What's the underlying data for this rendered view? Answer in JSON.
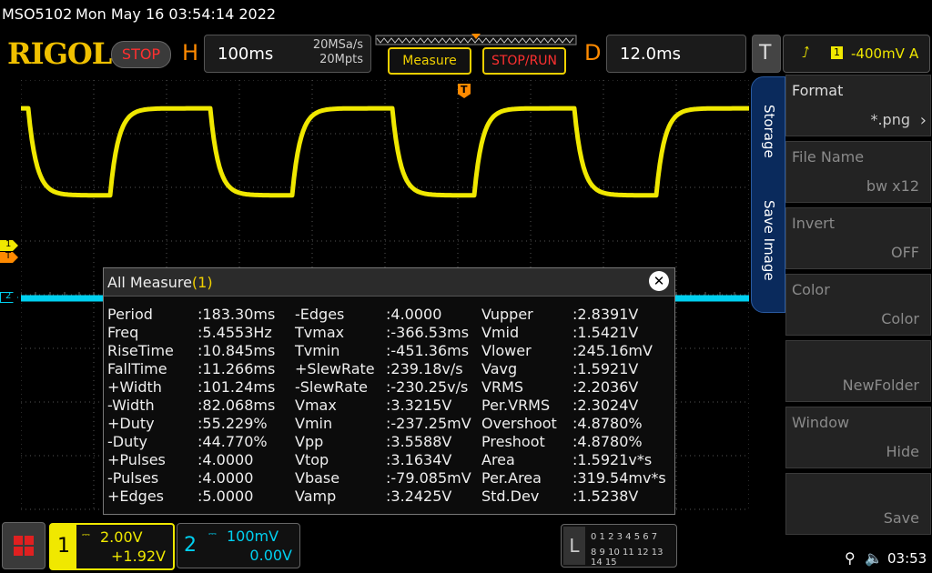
{
  "status": {
    "model": "MSO5102",
    "datetime": "Mon May 16 03:54:14 2022"
  },
  "brand": "RIGOL",
  "run_state": "STOP",
  "horizontal": {
    "label": "H",
    "timebase": "100ms",
    "sample_rate": "20MSa/s",
    "memory_depth": "20Mpts"
  },
  "buttons": {
    "measure": "Measure",
    "stop_run": "STOP/RUN"
  },
  "delay": {
    "label": "D",
    "value": "12.0ms"
  },
  "trigger": {
    "label": "T",
    "channel": "1",
    "level": "-400mV",
    "mode": "A"
  },
  "markers": {
    "ch1": "1",
    "ch2": "2",
    "trig": "T"
  },
  "measure_panel": {
    "title": "All Measure",
    "count": "(1)",
    "rows": [
      [
        [
          "Period",
          ":183.30ms"
        ],
        [
          "-Edges",
          ":4.0000"
        ],
        [
          "Vupper",
          ":2.8391V"
        ]
      ],
      [
        [
          "Freq",
          ":5.4553Hz"
        ],
        [
          "Tvmax",
          ":-366.53ms"
        ],
        [
          "Vmid",
          ":1.5421V"
        ]
      ],
      [
        [
          "RiseTime",
          ":10.845ms"
        ],
        [
          "Tvmin",
          ":-451.36ms"
        ],
        [
          "Vlower",
          ":245.16mV"
        ]
      ],
      [
        [
          "FallTime",
          ":11.266ms"
        ],
        [
          "+SlewRate",
          ":239.18v/s"
        ],
        [
          "Vavg",
          ":1.5921V"
        ]
      ],
      [
        [
          "+Width",
          ":101.24ms"
        ],
        [
          "-SlewRate",
          ":-230.25v/s"
        ],
        [
          "VRMS",
          ":2.2036V"
        ]
      ],
      [
        [
          "-Width",
          ":82.068ms"
        ],
        [
          "Vmax",
          ":3.3215V"
        ],
        [
          "Per.VRMS",
          ":2.3024V"
        ]
      ],
      [
        [
          "+Duty",
          ":55.229%"
        ],
        [
          "Vmin",
          ":-237.25mV"
        ],
        [
          "Overshoot",
          ":4.8780%"
        ]
      ],
      [
        [
          "-Duty",
          ":44.770%"
        ],
        [
          "Vpp",
          ":3.5588V"
        ],
        [
          "Preshoot",
          ":4.8780%"
        ]
      ],
      [
        [
          "+Pulses",
          ":4.0000"
        ],
        [
          "Vtop",
          ":3.1634V"
        ],
        [
          "Area",
          ":1.5921v*s"
        ]
      ],
      [
        [
          "-Pulses",
          ":4.0000"
        ],
        [
          "Vbase",
          ":-79.085mV"
        ],
        [
          "Per.Area",
          ":319.54mv*s"
        ]
      ],
      [
        [
          "+Edges",
          ":5.0000"
        ],
        [
          "Vamp",
          ":3.2425V"
        ],
        [
          "Std.Dev",
          ":1.5238V"
        ]
      ]
    ]
  },
  "side_tabs": {
    "storage": "Storage",
    "save_image": "Save Image"
  },
  "menu": [
    {
      "title": "Format",
      "value": "*.png",
      "enabled": true,
      "has_arrow": true
    },
    {
      "title": "File Name",
      "value": "bw x12",
      "enabled": false
    },
    {
      "title": "Invert",
      "value": "OFF",
      "enabled": false
    },
    {
      "title": "Color",
      "value": "Color",
      "enabled": false
    },
    {
      "title": "",
      "value": "NewFolder",
      "enabled": false
    },
    {
      "title": "Window",
      "value": "Hide",
      "enabled": false
    },
    {
      "title": "",
      "value": "Save",
      "enabled": false
    }
  ],
  "channel1": {
    "number": "1",
    "scale": "2.00V",
    "offset": "+1.92V"
  },
  "channel2": {
    "number": "2",
    "scale": "100mV",
    "offset": "0.00V"
  },
  "la": {
    "label": "L",
    "row1": "0 1 2 3  4 5 6 7",
    "row2": "8 9 10 11 12 13 14 15"
  },
  "clock": "03:53",
  "colors": {
    "ch1": "#f0e800",
    "ch2": "#00d0f0",
    "brand": "#f0c000",
    "trigger": "#ff8a00",
    "stop": "#ff3030"
  },
  "waveform": {
    "ch1_levels_V": [
      3.16,
      -0.08
    ],
    "ch2_level_V": 0.0
  }
}
